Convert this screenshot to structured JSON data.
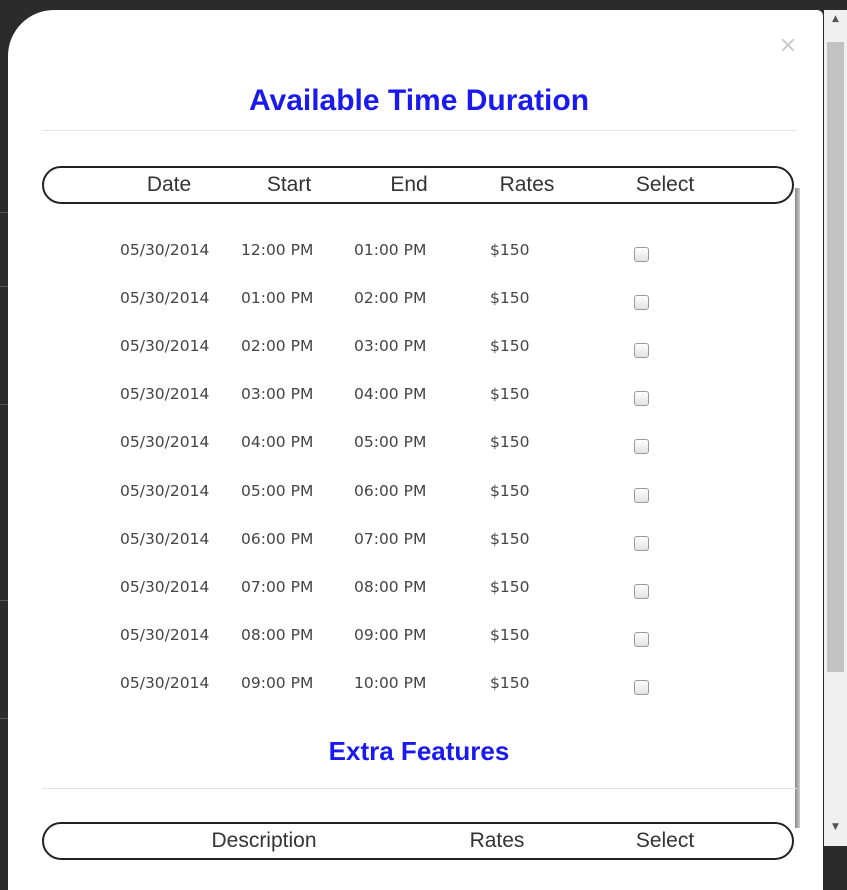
{
  "modal": {
    "close_label": "×",
    "title": "Available Time Duration",
    "table": {
      "headers": {
        "date": "Date",
        "start": "Start",
        "end": "End",
        "rates": "Rates",
        "select": "Select"
      },
      "rows": [
        {
          "date": "05/30/2014",
          "start": "12:00 PM",
          "end": "01:00 PM",
          "rate": "$150",
          "checked": false
        },
        {
          "date": "05/30/2014",
          "start": "01:00 PM",
          "end": "02:00 PM",
          "rate": "$150",
          "checked": false
        },
        {
          "date": "05/30/2014",
          "start": "02:00 PM",
          "end": "03:00 PM",
          "rate": "$150",
          "checked": false
        },
        {
          "date": "05/30/2014",
          "start": "03:00 PM",
          "end": "04:00 PM",
          "rate": "$150",
          "checked": false
        },
        {
          "date": "05/30/2014",
          "start": "04:00 PM",
          "end": "05:00 PM",
          "rate": "$150",
          "checked": false
        },
        {
          "date": "05/30/2014",
          "start": "05:00 PM",
          "end": "06:00 PM",
          "rate": "$150",
          "checked": false
        },
        {
          "date": "05/30/2014",
          "start": "06:00 PM",
          "end": "07:00 PM",
          "rate": "$150",
          "checked": false
        },
        {
          "date": "05/30/2014",
          "start": "07:00 PM",
          "end": "08:00 PM",
          "rate": "$150",
          "checked": false
        },
        {
          "date": "05/30/2014",
          "start": "08:00 PM",
          "end": "09:00 PM",
          "rate": "$150",
          "checked": false
        },
        {
          "date": "05/30/2014",
          "start": "09:00 PM",
          "end": "10:00 PM",
          "rate": "$150",
          "checked": false
        }
      ]
    },
    "extra_features": {
      "title": "Extra Features",
      "headers": {
        "description": "Description",
        "rates": "Rates",
        "select": "Select"
      }
    }
  },
  "scrollbar": {
    "up_icon": "▲",
    "down_icon": "▼"
  },
  "colors": {
    "title": "#1a1aee",
    "backdrop": "#2b2b2b",
    "text": "#444444"
  }
}
